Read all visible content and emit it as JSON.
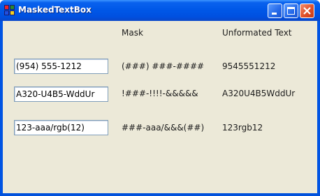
{
  "window": {
    "title": "MaskedTextBox"
  },
  "headers": {
    "mask": "Mask",
    "unformatted": "Unformated Text"
  },
  "rows": [
    {
      "value": "(954) 555-1212",
      "mask": "(###) ###-####",
      "unformatted": "9545551212"
    },
    {
      "value": "A320-U4B5-WddUr",
      "mask": "!###-!!!!-&&&&&",
      "unformatted": "A320U4B5WddUr"
    },
    {
      "value": "123-aaa/rgb(12)",
      "mask": "###-aaa/&&&(##)",
      "unformatted": "123rgb12"
    }
  ],
  "colors": {
    "titlebar": "#0058e8",
    "client_bg": "#ece9d8",
    "textbox_border": "#7f9db9",
    "close_button": "#e0502a"
  },
  "icons": {
    "app": "app-icon",
    "minimize": "minimize-icon",
    "maximize": "maximize-icon",
    "close": "close-icon"
  }
}
